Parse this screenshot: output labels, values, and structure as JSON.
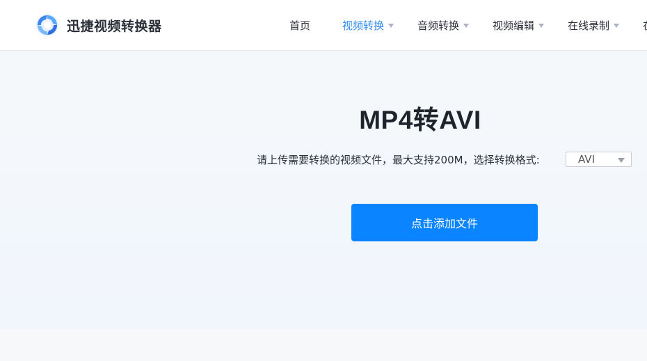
{
  "header": {
    "brand": "迅捷视频转换器",
    "nav": [
      {
        "label": "首页",
        "has_dropdown": false,
        "active": false
      },
      {
        "label": "视频转换",
        "has_dropdown": true,
        "active": true
      },
      {
        "label": "音频转换",
        "has_dropdown": true,
        "active": false
      },
      {
        "label": "视频编辑",
        "has_dropdown": true,
        "active": false
      },
      {
        "label": "在线录制",
        "has_dropdown": true,
        "active": false
      },
      {
        "label": "在",
        "has_dropdown": false,
        "active": false
      }
    ]
  },
  "main": {
    "title": "MP4转AVI",
    "upload_hint": "请上传需要转换的视频文件，最大支持200M，选择转换格式:",
    "format_select": {
      "value": "AVI"
    },
    "add_button_label": "点击添加文件"
  },
  "colors": {
    "accent": "#0a84ff",
    "active_nav": "#2f8cf0",
    "text_dark": "#1f232b"
  }
}
